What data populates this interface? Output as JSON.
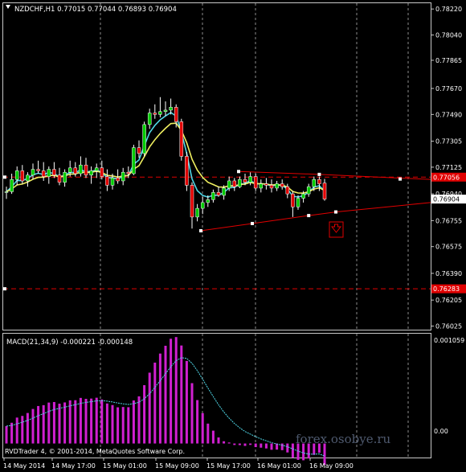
{
  "window": {
    "header": "NZDCHF,H1  0.77015 0.77044 0.76893 0.76904"
  },
  "colors": {
    "background": "#000000",
    "grid": "#c8c8c8",
    "bull_candle": "#00cc00",
    "bear_candle": "#e00000",
    "ma_fast": "#4fd6e6",
    "ma_slow": "#f0f060",
    "trendline": "#e00000",
    "macd_hist": "#d020d0",
    "macd_signal": "#4fd6e6"
  },
  "price_axis": {
    "labels": [
      "0.78220",
      "0.78040",
      "0.77865",
      "0.77670",
      "0.77490",
      "0.77305",
      "0.77125",
      "0.76940",
      "0.76755",
      "0.76575",
      "0.76390",
      "0.76205",
      "0.76025"
    ],
    "markers": [
      {
        "text": "0.77056",
        "bg": "#e00000",
        "value": 0.77056
      },
      {
        "text": "0.76904",
        "bg": "#ffffff",
        "value": 0.76904
      },
      {
        "text": "0.76283",
        "bg": "#e00000",
        "value": 0.76283
      }
    ]
  },
  "time_axis": {
    "labels": [
      "14 May 2014",
      "14 May 17:00",
      "15 May 01:00",
      "15 May 09:00",
      "15 May 17:00",
      "16 May 01:00",
      "16 May 09:00"
    ]
  },
  "macd": {
    "title": "MACD(21,34,9) -0.000221 -0.000148",
    "axis_labels": [
      "0.001059",
      "0.00"
    ]
  },
  "footer": {
    "copyright": "RVDTrader 4, © 2001-2014, MetaQuotes Software Corp.",
    "watermark": "forex.osobye.ru"
  },
  "chart_data": {
    "type": "candlestick",
    "symbol": "NZDCHF",
    "timeframe": "H1",
    "ohlc": [
      [
        0.7695,
        0.7699,
        0.76905,
        0.76955
      ],
      [
        0.76955,
        0.7708,
        0.7694,
        0.7704
      ],
      [
        0.7704,
        0.7713,
        0.77,
        0.771
      ],
      [
        0.771,
        0.7714,
        0.7701,
        0.7703
      ],
      [
        0.7703,
        0.7709,
        0.7699,
        0.7707
      ],
      [
        0.7707,
        0.7715,
        0.7704,
        0.7711
      ],
      [
        0.7711,
        0.7717,
        0.7708,
        0.771
      ],
      [
        0.771,
        0.7716,
        0.7703,
        0.7706
      ],
      [
        0.7706,
        0.7713,
        0.7701,
        0.7711
      ],
      [
        0.7711,
        0.7716,
        0.7705,
        0.7707
      ],
      [
        0.7707,
        0.7712,
        0.77,
        0.7702
      ],
      [
        0.7702,
        0.7711,
        0.7699,
        0.7709
      ],
      [
        0.7709,
        0.7717,
        0.7706,
        0.7712
      ],
      [
        0.7712,
        0.7716,
        0.7706,
        0.7708
      ],
      [
        0.7708,
        0.772,
        0.7706,
        0.7714
      ],
      [
        0.7714,
        0.7719,
        0.7705,
        0.7707
      ],
      [
        0.7707,
        0.7713,
        0.7701,
        0.771
      ],
      [
        0.771,
        0.7715,
        0.7705,
        0.7712
      ],
      [
        0.7712,
        0.7717,
        0.7704,
        0.7706
      ],
      [
        0.7706,
        0.7711,
        0.7696,
        0.77
      ],
      [
        0.77,
        0.7708,
        0.7697,
        0.7705
      ],
      [
        0.7705,
        0.7711,
        0.7701,
        0.7703
      ],
      [
        0.7703,
        0.7712,
        0.77,
        0.7709
      ],
      [
        0.7709,
        0.7713,
        0.7705,
        0.7708
      ],
      [
        0.7708,
        0.7728,
        0.7707,
        0.7726
      ],
      [
        0.7726,
        0.7731,
        0.7719,
        0.7722
      ],
      [
        0.7722,
        0.7744,
        0.772,
        0.7742
      ],
      [
        0.7742,
        0.7753,
        0.7739,
        0.775
      ],
      [
        0.775,
        0.7756,
        0.7746,
        0.7749
      ],
      [
        0.7749,
        0.7761,
        0.7747,
        0.7751
      ],
      [
        0.7751,
        0.7758,
        0.7748,
        0.7752
      ],
      [
        0.7752,
        0.776,
        0.7749,
        0.7754
      ],
      [
        0.7754,
        0.7756,
        0.774,
        0.7744
      ],
      [
        0.7744,
        0.7746,
        0.7717,
        0.772
      ],
      [
        0.772,
        0.7723,
        0.7696,
        0.77
      ],
      [
        0.77,
        0.7702,
        0.767,
        0.7678
      ],
      [
        0.7678,
        0.7687,
        0.7675,
        0.7684
      ],
      [
        0.7684,
        0.7692,
        0.768,
        0.7688
      ],
      [
        0.7688,
        0.7693,
        0.7685,
        0.769
      ],
      [
        0.769,
        0.7697,
        0.7688,
        0.7695
      ],
      [
        0.7695,
        0.7699,
        0.7692,
        0.7693
      ],
      [
        0.7693,
        0.77,
        0.769,
        0.7698
      ],
      [
        0.7698,
        0.7706,
        0.7696,
        0.7703
      ],
      [
        0.7703,
        0.7705,
        0.7696,
        0.7699
      ],
      [
        0.7699,
        0.7706,
        0.7698,
        0.7704
      ],
      [
        0.7704,
        0.7708,
        0.77,
        0.7702
      ],
      [
        0.7702,
        0.7709,
        0.77,
        0.7706
      ],
      [
        0.7706,
        0.7708,
        0.7696,
        0.7698
      ],
      [
        0.7698,
        0.7704,
        0.7695,
        0.7701
      ],
      [
        0.7701,
        0.7705,
        0.7697,
        0.77
      ],
      [
        0.77,
        0.7704,
        0.7695,
        0.7698
      ],
      [
        0.7698,
        0.7703,
        0.7696,
        0.7701
      ],
      [
        0.7701,
        0.7704,
        0.7697,
        0.7699
      ],
      [
        0.7699,
        0.7701,
        0.7691,
        0.7694
      ],
      [
        0.7694,
        0.7696,
        0.7678,
        0.7685
      ],
      [
        0.7685,
        0.7693,
        0.7683,
        0.7691
      ],
      [
        0.7691,
        0.7696,
        0.7688,
        0.7694
      ],
      [
        0.7694,
        0.7701,
        0.7692,
        0.7699
      ],
      [
        0.7699,
        0.7706,
        0.7696,
        0.7704
      ],
      [
        0.7704,
        0.7706,
        0.7696,
        0.7701
      ],
      [
        0.77015,
        0.77044,
        0.76893,
        0.76904
      ]
    ],
    "price_range": [
      0.76,
      0.7826
    ],
    "time_labels": [
      "14 May 2014",
      "14 May 17:00",
      "15 May 01:00",
      "15 May 09:00",
      "15 May 17:00",
      "16 May 01:00",
      "16 May 09:00"
    ],
    "indicators": {
      "moving_averages": [
        "fast",
        "slow"
      ],
      "macd_params": [
        21,
        34,
        9
      ],
      "macd_value": -0.000221,
      "macd_signal": -0.000148,
      "macd_range": [
        -0.00012,
        0.00106
      ]
    }
  }
}
